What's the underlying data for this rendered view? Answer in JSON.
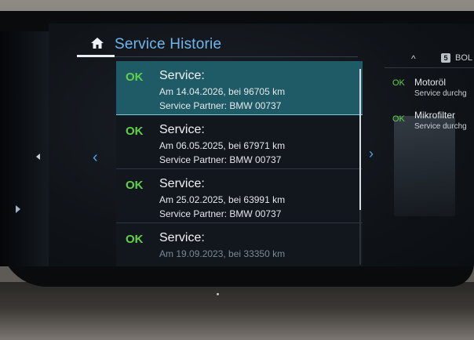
{
  "header": {
    "title": "Service Historie",
    "home_icon": "home-icon"
  },
  "nav": {
    "left_arrow": "‹",
    "right_arrow": "›"
  },
  "service_list": [
    {
      "status": "OK",
      "title": "Service:",
      "line1": "Am 14.04.2026, bei 96705 km",
      "line2": "Service Partner: BMW 00737",
      "selected": true
    },
    {
      "status": "OK",
      "title": "Service:",
      "line1": "Am 06.05.2025, bei 67971 km",
      "line2": "Service Partner: BMW 00737",
      "selected": false
    },
    {
      "status": "OK",
      "title": "Service:",
      "line1": "Am 25.02.2025, bei 63991 km",
      "line2": "Service Partner: BMW 00737",
      "selected": false
    },
    {
      "status": "OK",
      "title": "Service:",
      "line1": "Am 19.09.2023, bei 33350 km",
      "line2": "",
      "selected": false
    }
  ],
  "side_panel": {
    "chevron": "^",
    "badge": "5",
    "label": "BOL",
    "items": [
      {
        "status": "OK",
        "title": "Motoröl",
        "subtitle": "Service durchg"
      },
      {
        "status": "OK",
        "title": "Mikrofilter",
        "subtitle": "Service durchg"
      }
    ]
  },
  "colors": {
    "accent": "#6fb6ee",
    "ok_green": "#5fd247",
    "selected_row": "#1f5b66",
    "screen_bg": "#12171d"
  }
}
